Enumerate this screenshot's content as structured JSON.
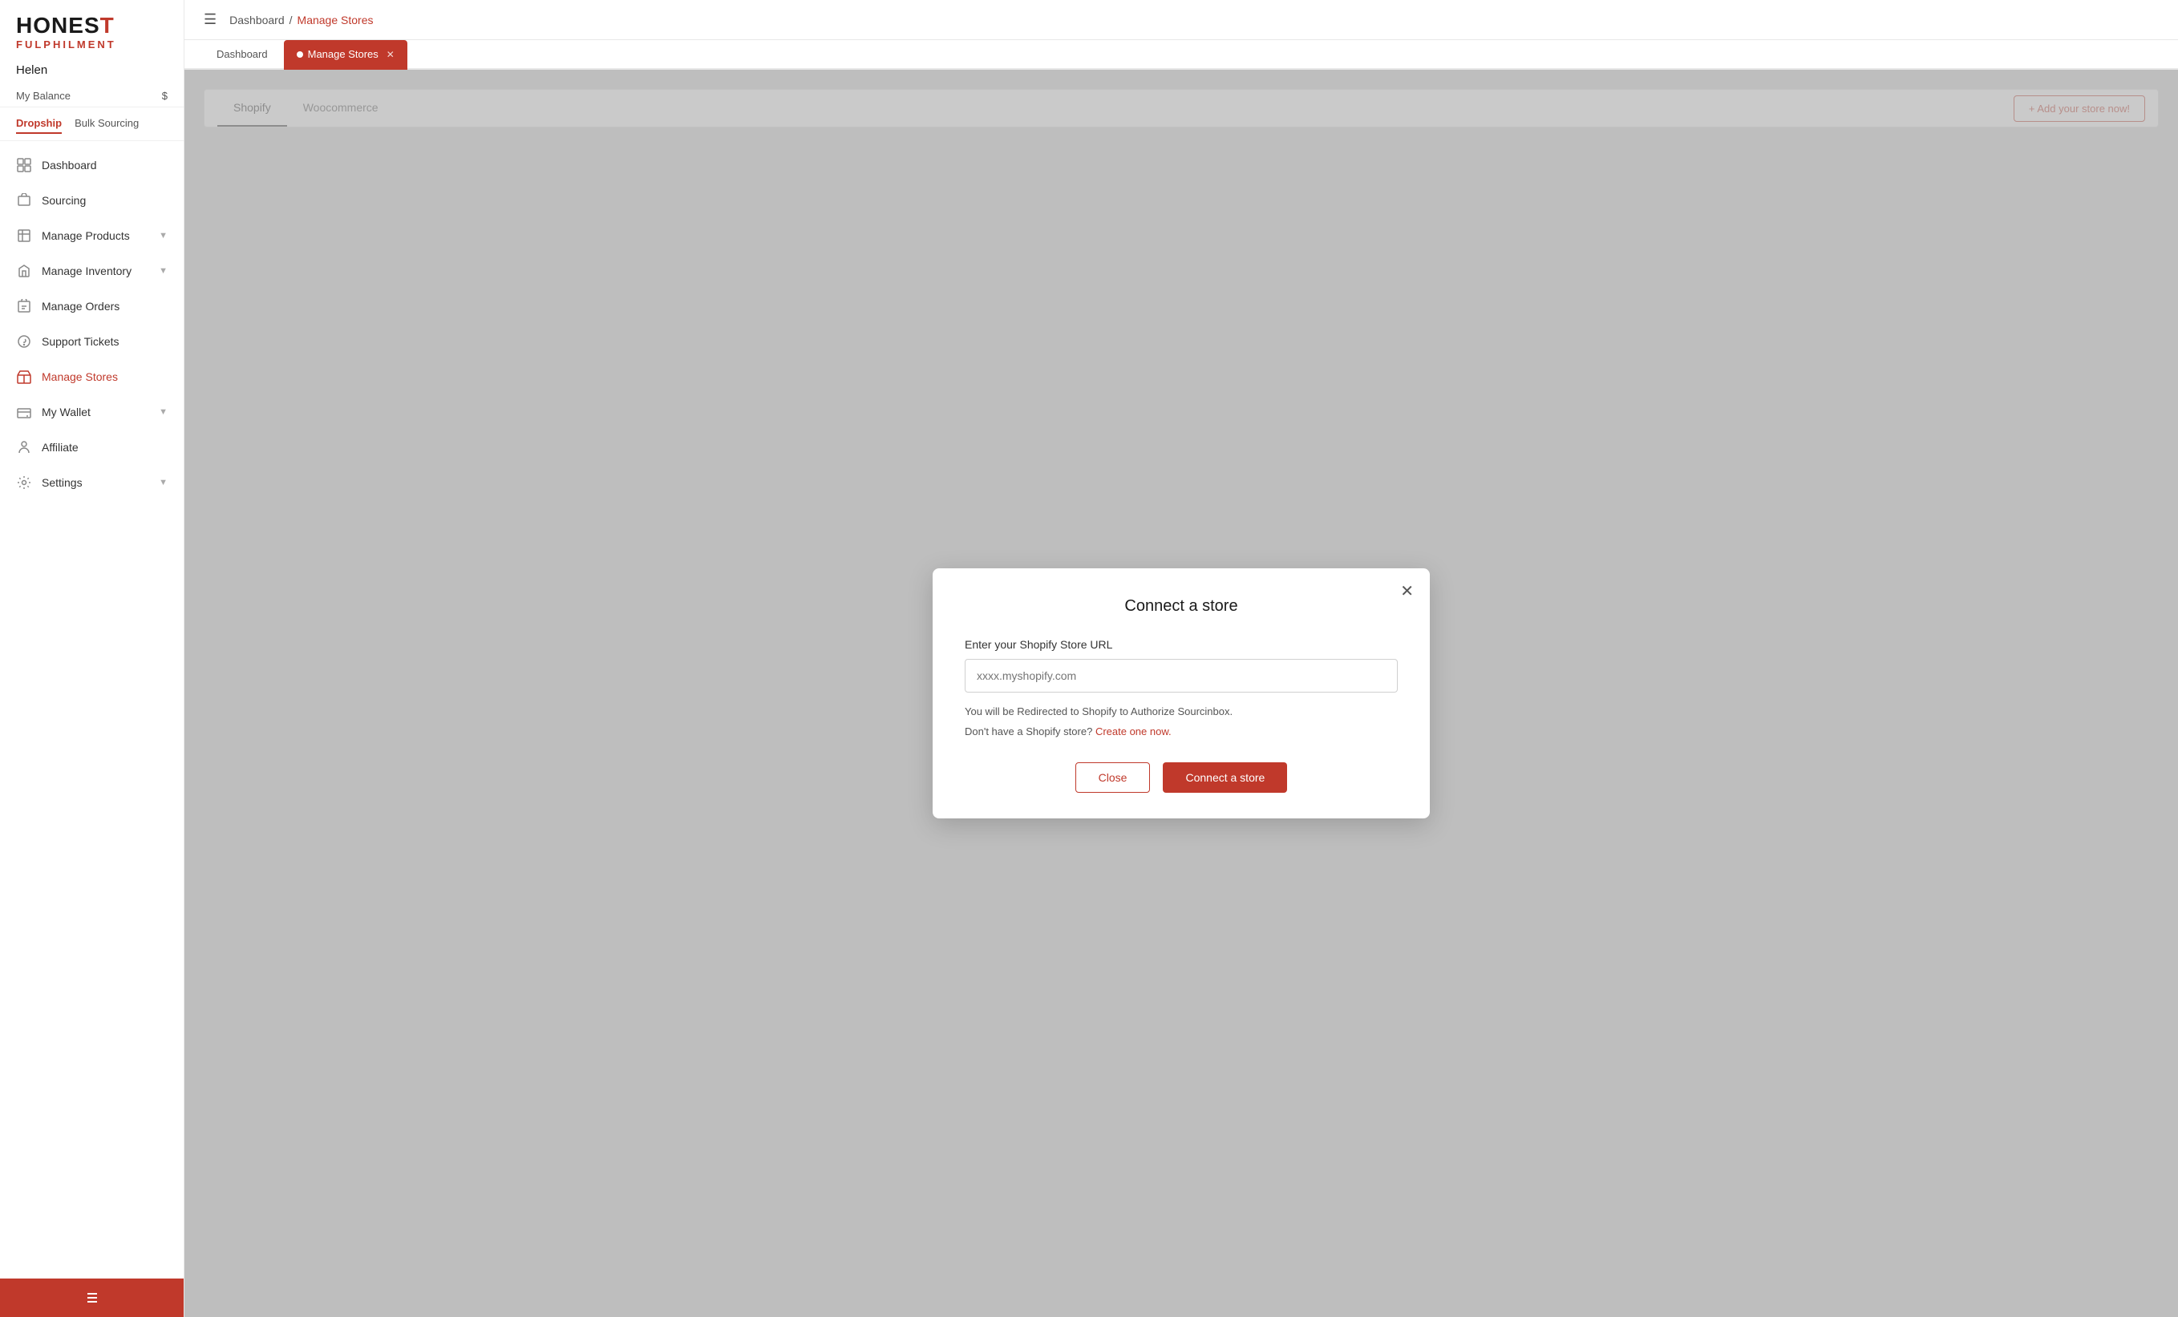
{
  "app": {
    "logo_honest": "HONEST",
    "logo_fulphilment": "FULPHILMENT",
    "user_name": "Helen"
  },
  "sidebar": {
    "balance_label": "My Balance",
    "balance_value": "$",
    "tabs": [
      {
        "id": "dropship",
        "label": "Dropship",
        "active": true
      },
      {
        "id": "bulk",
        "label": "Bulk Sourcing",
        "active": false
      }
    ],
    "nav_items": [
      {
        "id": "dashboard",
        "label": "Dashboard",
        "icon": "dashboard-icon",
        "active": false,
        "has_chevron": false
      },
      {
        "id": "sourcing",
        "label": "Sourcing",
        "icon": "sourcing-icon",
        "active": false,
        "has_chevron": false
      },
      {
        "id": "manage-products",
        "label": "Manage Products",
        "icon": "products-icon",
        "active": false,
        "has_chevron": true
      },
      {
        "id": "manage-inventory",
        "label": "Manage Inventory",
        "icon": "inventory-icon",
        "active": false,
        "has_chevron": true
      },
      {
        "id": "manage-orders",
        "label": "Manage Orders",
        "icon": "orders-icon",
        "active": false,
        "has_chevron": false
      },
      {
        "id": "support-tickets",
        "label": "Support Tickets",
        "icon": "support-icon",
        "active": false,
        "has_chevron": false
      },
      {
        "id": "manage-stores",
        "label": "Manage Stores",
        "icon": "stores-icon",
        "active": true,
        "has_chevron": false
      },
      {
        "id": "my-wallet",
        "label": "My Wallet",
        "icon": "wallet-icon",
        "active": false,
        "has_chevron": true
      },
      {
        "id": "affiliate",
        "label": "Affiliate",
        "icon": "affiliate-icon",
        "active": false,
        "has_chevron": false
      },
      {
        "id": "settings",
        "label": "Settings",
        "icon": "settings-icon",
        "active": false,
        "has_chevron": true
      }
    ]
  },
  "topbar": {
    "breadcrumb_home": "Dashboard",
    "breadcrumb_sep": "/",
    "breadcrumb_current": "Manage Stores"
  },
  "tabs_bar": {
    "tabs": [
      {
        "id": "dashboard",
        "label": "Dashboard",
        "active": false
      },
      {
        "id": "manage-stores",
        "label": "Manage Stores",
        "active": true
      }
    ]
  },
  "store_section": {
    "tabs": [
      {
        "id": "shopify",
        "label": "Shopify",
        "active": true
      },
      {
        "id": "woocommerce",
        "label": "Woocommerce",
        "active": false
      }
    ],
    "add_store_label": "+ Add your store now!"
  },
  "modal": {
    "title": "Connect a store",
    "label": "Enter your Shopify Store URL",
    "placeholder": "xxxx.myshopify.com",
    "info_line1": "You will be Redirected to Shopify to Authorize Sourcinbox.",
    "info_line2_prefix": "Don't have a Shopify store?",
    "info_link": "Create one now.",
    "btn_close": "Close",
    "btn_connect": "Connect a store"
  }
}
